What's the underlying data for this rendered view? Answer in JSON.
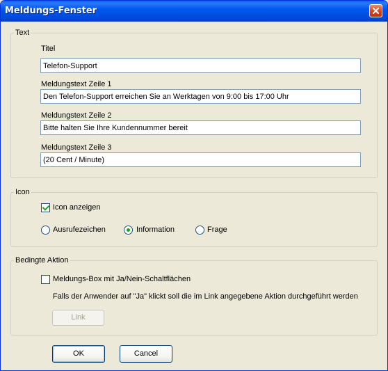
{
  "window": {
    "title": "Meldungs-Fenster"
  },
  "text_group": {
    "legend": "Text",
    "title_label": "Titel",
    "title_value": "Telefon-Support",
    "line1_label": "Meldungstext Zeile 1",
    "line1_value": "Den Telefon-Support erreichen Sie an Werktagen von 9:00 bis 17:00 Uhr",
    "line2_label": "Meldungstext Zeile 2",
    "line2_value": "Bitte halten Sie Ihre Kundennummer bereit",
    "line3_label": "Meldungstext Zeile 3",
    "line3_value": "(20 Cent / Minute)"
  },
  "icon_group": {
    "legend": "Icon",
    "show_icon_label": "Icon anzeigen",
    "show_icon_checked": true,
    "options": [
      "Ausrufezeichen",
      "Information",
      "Frage"
    ],
    "selected": "Information"
  },
  "action_group": {
    "legend": "Bedingte Aktion",
    "yesno_label": "Meldungs-Box mit Ja/Nein-Schaltflächen",
    "yesno_checked": false,
    "hint": "Falls der Anwender auf \"Ja\" klickt soll die im Link angegebene Aktion durchgeführt werden",
    "link_button": "Link"
  },
  "buttons": {
    "ok": "OK",
    "cancel": "Cancel"
  }
}
